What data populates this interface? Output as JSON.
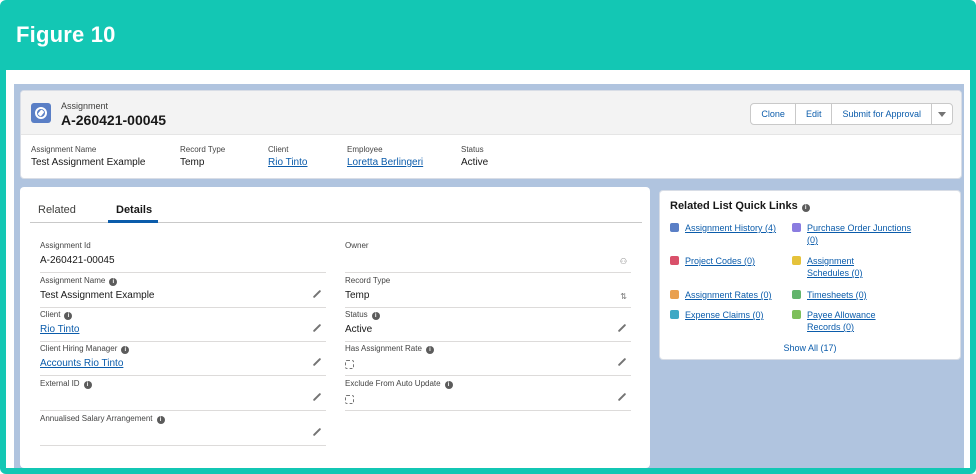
{
  "figure": {
    "title": "Figure 10"
  },
  "header": {
    "object_type": "Assignment",
    "record_name": "A-260421-00045",
    "actions": {
      "clone": "Clone",
      "edit": "Edit",
      "submit": "Submit for Approval"
    },
    "highlights": {
      "assignment_name": {
        "label": "Assignment Name",
        "value": "Test Assignment Example"
      },
      "record_type": {
        "label": "Record Type",
        "value": "Temp"
      },
      "client": {
        "label": "Client",
        "value": "Rio Tinto"
      },
      "employee": {
        "label": "Employee",
        "value": "Loretta Berlingeri"
      },
      "status": {
        "label": "Status",
        "value": "Active"
      }
    }
  },
  "tabs": {
    "related": "Related",
    "details": "Details"
  },
  "details": {
    "assignment_id": {
      "label": "Assignment Id",
      "value": "A-260421-00045"
    },
    "owner": {
      "label": "Owner",
      "value": ""
    },
    "assignment_name": {
      "label": "Assignment Name",
      "value": "Test Assignment Example"
    },
    "record_type": {
      "label": "Record Type",
      "value": "Temp"
    },
    "client": {
      "label": "Client",
      "value": "Rio Tinto"
    },
    "status": {
      "label": "Status",
      "value": "Active"
    },
    "client_hiring_manager": {
      "label": "Client Hiring Manager",
      "value": "Accounts Rio Tinto"
    },
    "has_assignment_rate": {
      "label": "Has Assignment Rate",
      "value": ""
    },
    "external_id": {
      "label": "External ID",
      "value": ""
    },
    "exclude_auto_update": {
      "label": "Exclude From Auto Update",
      "value": ""
    },
    "annualised_salary": {
      "label": "Annualised Salary Arrangement",
      "value": ""
    }
  },
  "quick_links": {
    "title": "Related List Quick Links",
    "items": [
      {
        "label": "Assignment History (4)",
        "color": "#5a7fc6"
      },
      {
        "label": "Purchase Order Junctions (0)",
        "color": "#8a7ce0"
      },
      {
        "label": "Project Codes (0)",
        "color": "#d9506a"
      },
      {
        "label": "Assignment Schedules (0)",
        "color": "#e5c23a"
      },
      {
        "label": "Assignment Rates (0)",
        "color": "#e9a050"
      },
      {
        "label": "Timesheets (0)",
        "color": "#62b46c"
      },
      {
        "label": "Expense Claims (0)",
        "color": "#3fa9c5"
      },
      {
        "label": "Payee Allowance Records (0)",
        "color": "#7dbf5a"
      }
    ],
    "show_all": "Show All (17)"
  }
}
